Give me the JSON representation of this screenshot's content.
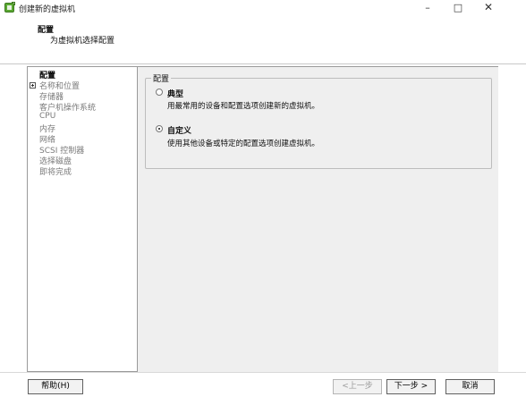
{
  "window": {
    "title": "创建新的虚拟机",
    "minimize_glyph": "–",
    "maximize_glyph": "□",
    "close_glyph": "✕",
    "icon": "vm-wizard-icon"
  },
  "header": {
    "title": "配置",
    "subtitle": "为虚拟机选择配置"
  },
  "nav": {
    "items": [
      {
        "label": "配置",
        "active": true
      },
      {
        "label": "名称和位置",
        "active": false
      },
      {
        "label": "存储器",
        "active": false
      },
      {
        "label": "客户机操作系统",
        "active": false
      },
      {
        "label": "CPU",
        "active": false
      },
      {
        "label": "内存",
        "active": false
      },
      {
        "label": "网络",
        "active": false
      },
      {
        "label": "SCSI 控制器",
        "active": false
      },
      {
        "label": "选择磁盘",
        "active": false
      },
      {
        "label": "即将完成",
        "active": false
      }
    ]
  },
  "config": {
    "group_label": "配置",
    "options": [
      {
        "label": "典型",
        "description": "用最常用的设备和配置选项创建新的虚拟机。",
        "checked": false
      },
      {
        "label": "自定义",
        "description": "使用其他设备或特定的配置选项创建虚拟机。",
        "checked": true
      }
    ]
  },
  "footer": {
    "help": "帮助(H)",
    "prev": "<上一步",
    "next": "下一步 >",
    "cancel": "取消"
  },
  "colors": {
    "content_bg": "#efefef",
    "border": "#9a9a9a",
    "disabled_text": "#9a9a9a",
    "icon_green": "#5aa832"
  }
}
